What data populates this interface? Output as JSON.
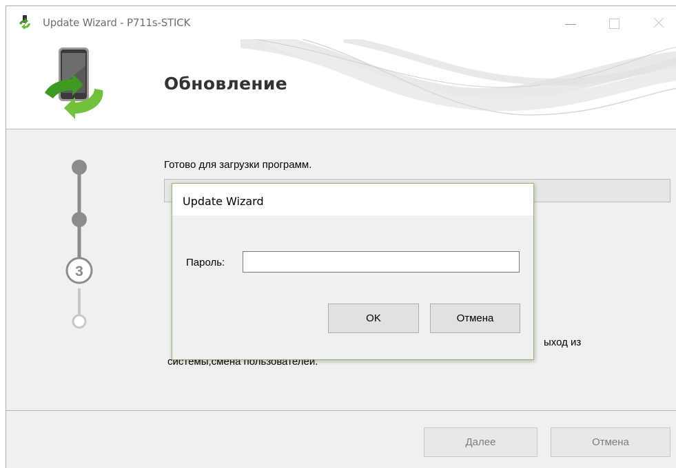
{
  "window": {
    "title": "Update Wizard - P711s-STICK",
    "header_title": "Обновление"
  },
  "steps": {
    "current": "3"
  },
  "content": {
    "status_label": "Готово для загрузки программ.",
    "warning_line1_tail": "ыход из",
    "warning_line2": "системы,смена пользователей."
  },
  "footer": {
    "next_label": "Далее",
    "cancel_label": "Отмена"
  },
  "dialog": {
    "title": "Update Wizard",
    "password_label": "Пароль:",
    "password_value": "",
    "ok_label": "OK",
    "cancel_label": "Отмена"
  },
  "colors": {
    "accent_green": "#5aa82f",
    "step_gray": "#8c8c8c",
    "dialog_border": "#8fbd66"
  },
  "icons": {
    "title": "update-wizard-icon",
    "header": "phone-sync-icon"
  }
}
